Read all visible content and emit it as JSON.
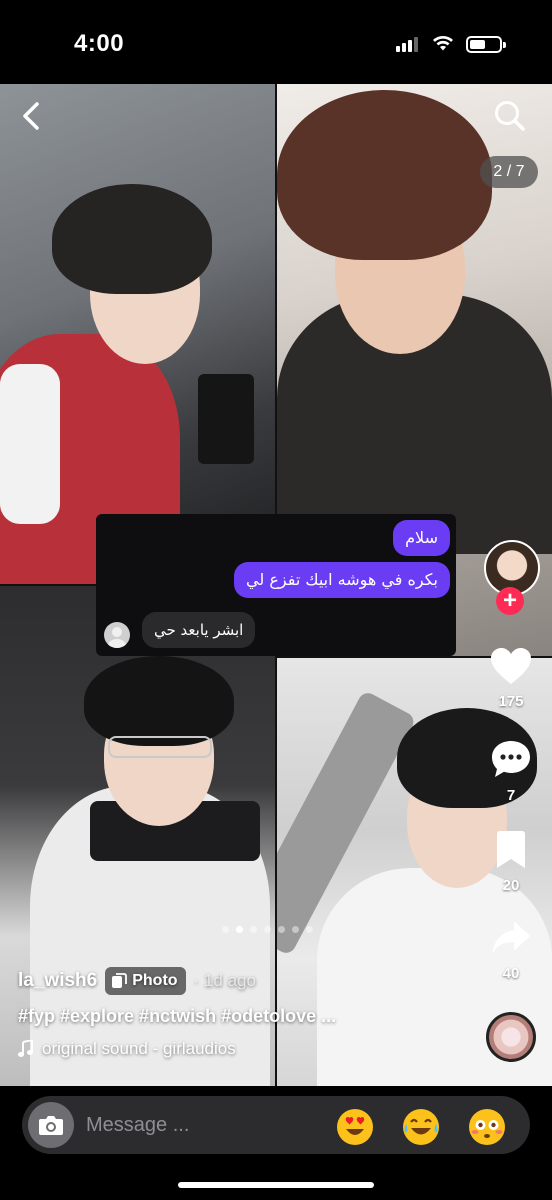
{
  "status_bar": {
    "time": "4:00",
    "battery_level": 0.55
  },
  "header": {
    "page_counter": "2 / 7"
  },
  "chat": {
    "outgoing": [
      "سلام",
      "بكره في هوشه ابيك تفزع لي"
    ],
    "incoming": "ابشر يابعد حي"
  },
  "actions": {
    "likes": "175",
    "comments": "7",
    "saves": "20",
    "shares": "40"
  },
  "carousel": {
    "total": 7,
    "active_index": 1
  },
  "caption": {
    "username": "la_wish6",
    "badge_label": "Photo",
    "date": "· 1d ago",
    "hashtags": "#fyp #explore #nctwish #odetolove ...",
    "sound": "original sound - girlaudios"
  },
  "message_bar": {
    "placeholder": "Message ..."
  },
  "icons": {
    "back": "chevron-left-icon",
    "search": "search-icon",
    "like": "heart-icon",
    "comment": "comment-icon",
    "save": "bookmark-icon",
    "share": "share-arrow-icon",
    "sound": "music-note-icon",
    "camera": "camera-icon"
  },
  "colors": {
    "accent_purple": "#6a3df5",
    "follow_red": "#fe2c55"
  }
}
